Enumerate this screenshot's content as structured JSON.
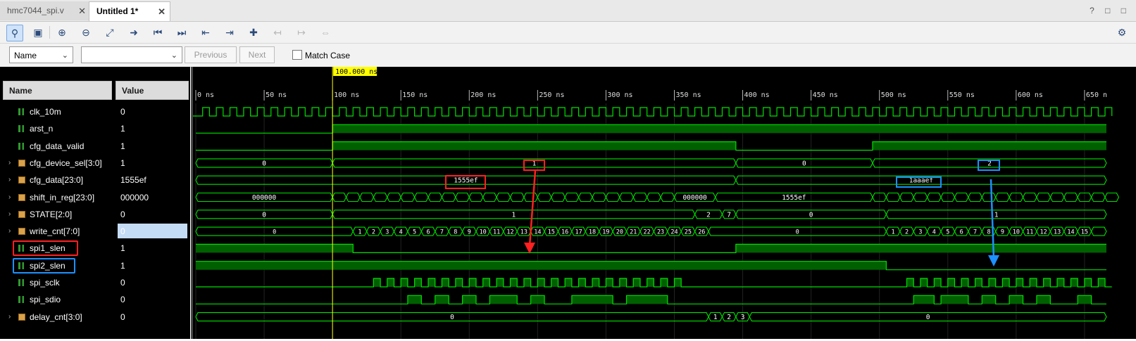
{
  "tabs": [
    {
      "label": "hmc7044_spi.v",
      "close": "✕"
    },
    {
      "label": "Untitled 1*",
      "close": "✕"
    }
  ],
  "window_controls": "? □ □",
  "search": {
    "field_select": "Name",
    "value_select": "",
    "previous": "Previous",
    "next": "Next",
    "match_case": "Match Case"
  },
  "columns": {
    "name": "Name",
    "value": "Value"
  },
  "cursor_label": "100.000 ns",
  "time_ticks": [
    "0 ns",
    "50 ns",
    "100 ns",
    "150 ns",
    "200 ns",
    "250 ns",
    "300 ns",
    "350 ns",
    "400 ns",
    "450 ns",
    "500 ns",
    "550 ns",
    "600 ns",
    "650 n"
  ],
  "signals": [
    {
      "name": "clk_10m",
      "value": "0",
      "kind": "wire",
      "expand": false
    },
    {
      "name": "arst_n",
      "value": "1",
      "kind": "wire",
      "expand": false
    },
    {
      "name": "cfg_data_valid",
      "value": "1",
      "kind": "wire",
      "expand": false
    },
    {
      "name": "cfg_device_sel[3:0]",
      "value": "1",
      "kind": "bus",
      "expand": true,
      "selected": true
    },
    {
      "name": "cfg_data[23:0]",
      "value": "1555ef",
      "kind": "bus",
      "expand": true
    },
    {
      "name": "shift_in_reg[23:0]",
      "value": "000000",
      "kind": "bus",
      "expand": true
    },
    {
      "name": "STATE[2:0]",
      "value": "0",
      "kind": "bus",
      "expand": true
    },
    {
      "name": "write_cnt[7:0]",
      "value": "0",
      "kind": "bus",
      "expand": true
    },
    {
      "name": "spi1_slen",
      "value": "1",
      "kind": "wire",
      "expand": false
    },
    {
      "name": "spi2_slen",
      "value": "1",
      "kind": "wire",
      "expand": false
    },
    {
      "name": "spi_sclk",
      "value": "0",
      "kind": "wire",
      "expand": false
    },
    {
      "name": "spi_sdio",
      "value": "0",
      "kind": "wire",
      "expand": false
    },
    {
      "name": "delay_cnt[3:0]",
      "value": "0",
      "kind": "bus",
      "expand": true
    }
  ],
  "bus_values": {
    "cfg_device_sel": [
      "0",
      "1",
      "0",
      "2"
    ],
    "cfg_data": [
      "1555ef",
      "1aaaef"
    ],
    "shift_in_reg": [
      "000000",
      "000000",
      "1555ef"
    ],
    "STATE": [
      "0",
      "1",
      "2",
      "7",
      "0",
      "1"
    ],
    "write_cnt": [
      "0",
      "1",
      "2",
      "3",
      "4",
      "5",
      "6",
      "7",
      "8",
      "9",
      "10",
      "11",
      "12",
      "13",
      "14",
      "15",
      "16",
      "17",
      "18",
      "19",
      "20",
      "21",
      "22",
      "23",
      "24",
      "25",
      "26",
      "0",
      "1",
      "2",
      "3",
      "4",
      "5",
      "6",
      "7",
      "8",
      "9",
      "10",
      "11",
      "12",
      "13",
      "14",
      "15"
    ],
    "delay_cnt": [
      "0",
      "1",
      "2",
      "3",
      "0"
    ]
  },
  "colors": {
    "wave": "#00e000",
    "fill": "#006000",
    "cursor": "#ffff00",
    "red_annot": "#ff2020",
    "blue_annot": "#1e90ff"
  }
}
